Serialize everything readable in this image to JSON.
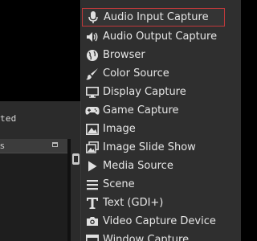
{
  "log": {
    "status_text": "ted"
  },
  "panel": {
    "header_text": "s"
  },
  "menu": {
    "items": [
      {
        "label": "Audio Input Capture",
        "icon": "microphone-icon",
        "selected": true
      },
      {
        "label": "Audio Output Capture",
        "icon": "speaker-icon"
      },
      {
        "label": "Browser",
        "icon": "globe-icon"
      },
      {
        "label": "Color Source",
        "icon": "paintbrush-icon"
      },
      {
        "label": "Display Capture",
        "icon": "monitor-icon"
      },
      {
        "label": "Game Capture",
        "icon": "gamepad-icon"
      },
      {
        "label": "Image",
        "icon": "image-icon"
      },
      {
        "label": "Image Slide Show",
        "icon": "slideshow-icon"
      },
      {
        "label": "Media Source",
        "icon": "play-icon"
      },
      {
        "label": "Scene",
        "icon": "list-icon"
      },
      {
        "label": "Text (GDI+)",
        "icon": "text-icon"
      },
      {
        "label": "Video Capture Device",
        "icon": "camera-icon"
      },
      {
        "label": "Window Capture",
        "icon": "window-icon"
      }
    ]
  },
  "colors": {
    "menu_background": "#2f2f2f",
    "selection_border": "#c0393b",
    "text": "#e6e6e6",
    "icon": "#e0e0e0"
  }
}
